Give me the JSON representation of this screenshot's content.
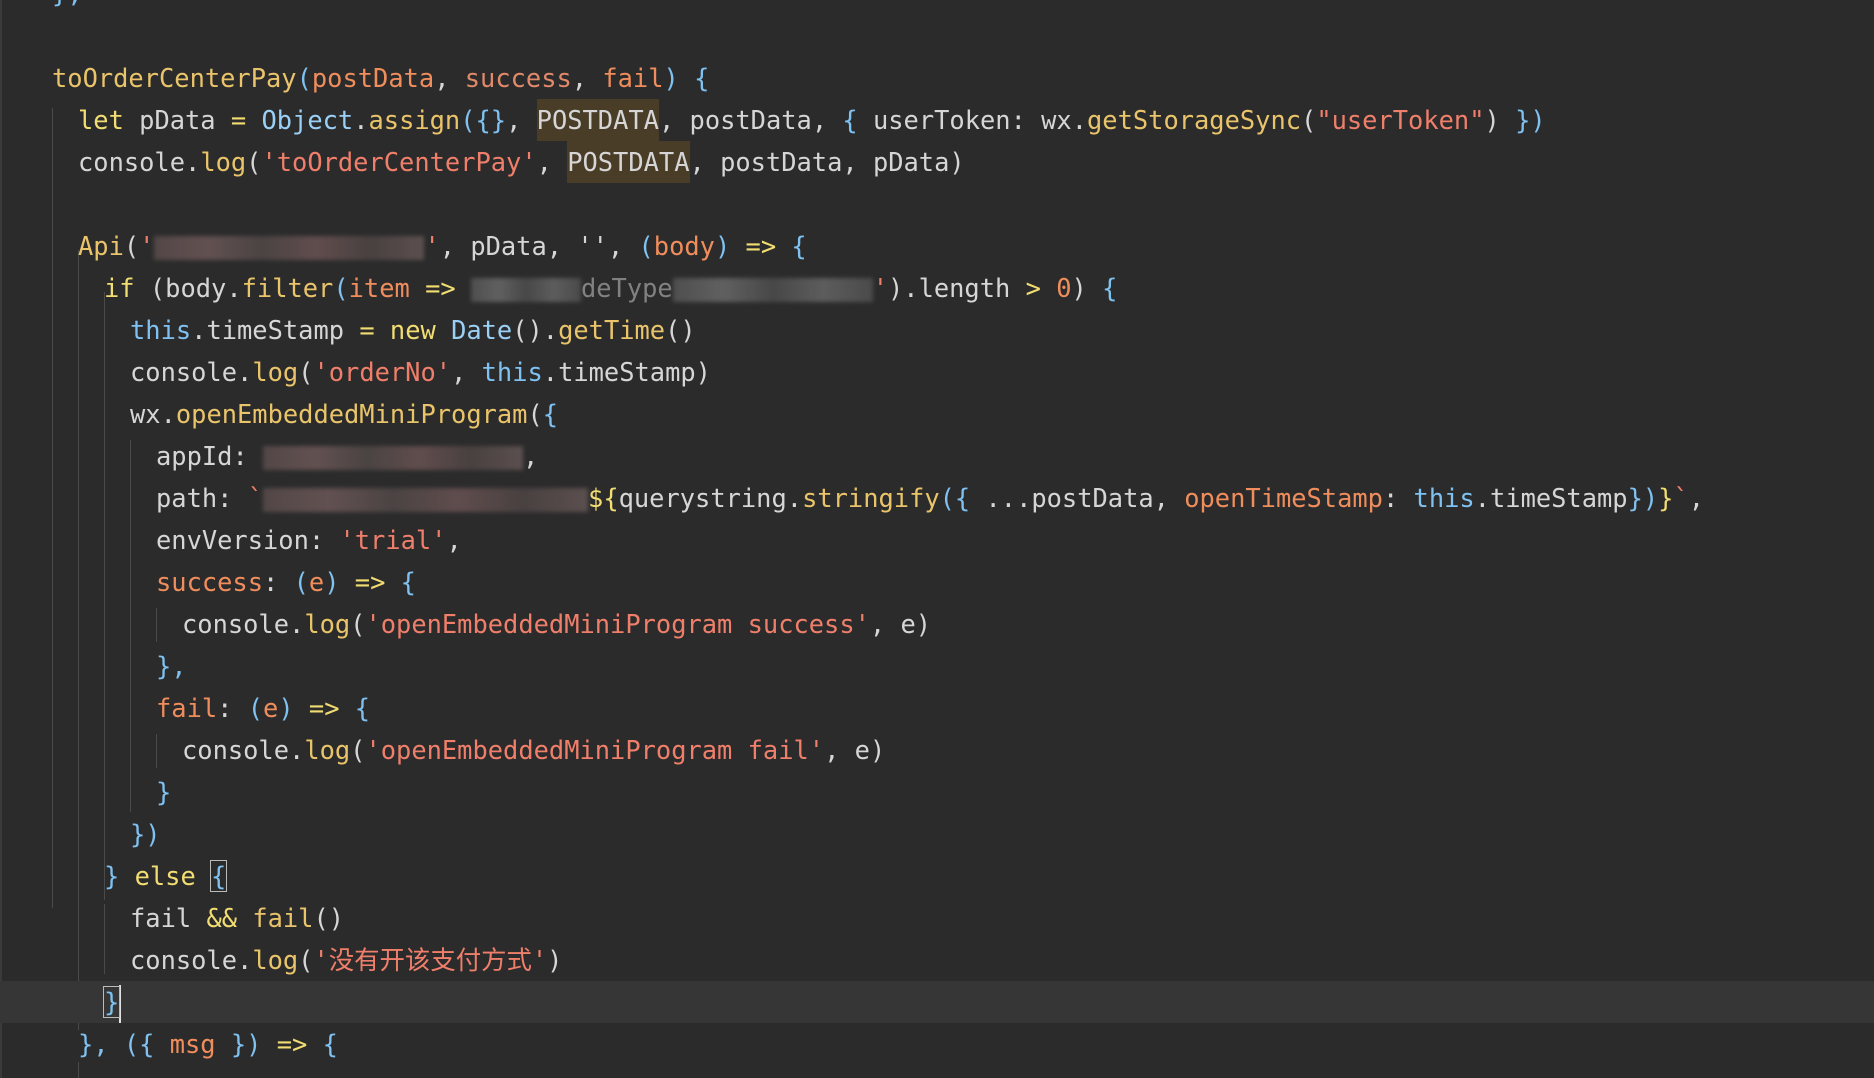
{
  "editor": {
    "lines": [
      {
        "id": "l0",
        "text": "},"
      },
      {
        "id": "l1",
        "text": ""
      },
      {
        "id": "l2",
        "name": "toOrderCenterPay",
        "params": [
          "postData",
          "success",
          "fail"
        ]
      },
      {
        "id": "l3",
        "let_kw": "let",
        "var": "pData",
        "obj": "Object",
        "method": "assign",
        "arg_hl": "POSTDATA",
        "arg2": "postData",
        "key": "userToken",
        "wx": "wx",
        "call": "getStorageSync",
        "str": "\"userToken\""
      },
      {
        "id": "l4",
        "console": "console",
        "log": "log",
        "str": "'toOrderCenterPay'",
        "arg_hl": "POSTDATA",
        "args": "postData, pData)"
      },
      {
        "id": "l5",
        "text": ""
      },
      {
        "id": "l6",
        "api": "Api",
        "args": "pData, '', ",
        "param": "body"
      },
      {
        "id": "l7",
        "if_kw": "if",
        "body": "body",
        "filter": "filter",
        "item": "item",
        "visible_fragment": "deType",
        "length": ".length",
        "num": "0"
      },
      {
        "id": "l8",
        "this_kw": "this",
        "prop": "timeStamp",
        "new_kw": "new",
        "cls": "Date",
        "method": "getTime"
      },
      {
        "id": "l9",
        "console": "console",
        "log": "log",
        "str": "'orderNo'",
        "this_kw": "this",
        "prop": "timeStamp"
      },
      {
        "id": "l10",
        "wx": "wx",
        "method": "openEmbeddedMiniProgram"
      },
      {
        "id": "l11",
        "key": "appId"
      },
      {
        "id": "l12",
        "key": "path",
        "qs": "querystring",
        "stringify": "stringify",
        "spread": "...postData",
        "key2": "openTimeStamp",
        "this_kw": "this",
        "prop": "timeStamp"
      },
      {
        "id": "l13",
        "key": "envVersion",
        "str": "'trial'"
      },
      {
        "id": "l14",
        "key": "success",
        "param": "e"
      },
      {
        "id": "l15",
        "console": "console",
        "log": "log",
        "str": "'openEmbeddedMiniProgram success'",
        "arg": "e"
      },
      {
        "id": "l16",
        "text": "},"
      },
      {
        "id": "l17",
        "key": "fail",
        "param": "e"
      },
      {
        "id": "l18",
        "console": "console",
        "log": "log",
        "str": "'openEmbeddedMiniProgram fail'",
        "arg": "e"
      },
      {
        "id": "l19",
        "text": "}"
      },
      {
        "id": "l20",
        "text": "})"
      },
      {
        "id": "l21",
        "else_kw": "else"
      },
      {
        "id": "l22",
        "fail": "fail",
        "op": "&&",
        "fail_call": "fail"
      },
      {
        "id": "l23",
        "console": "console",
        "log": "log",
        "str": "'没有开该支付方式'"
      },
      {
        "id": "l24",
        "text": "}"
      },
      {
        "id": "l25",
        "param": "msg"
      },
      {
        "id": "l26",
        "text": ""
      }
    ]
  }
}
